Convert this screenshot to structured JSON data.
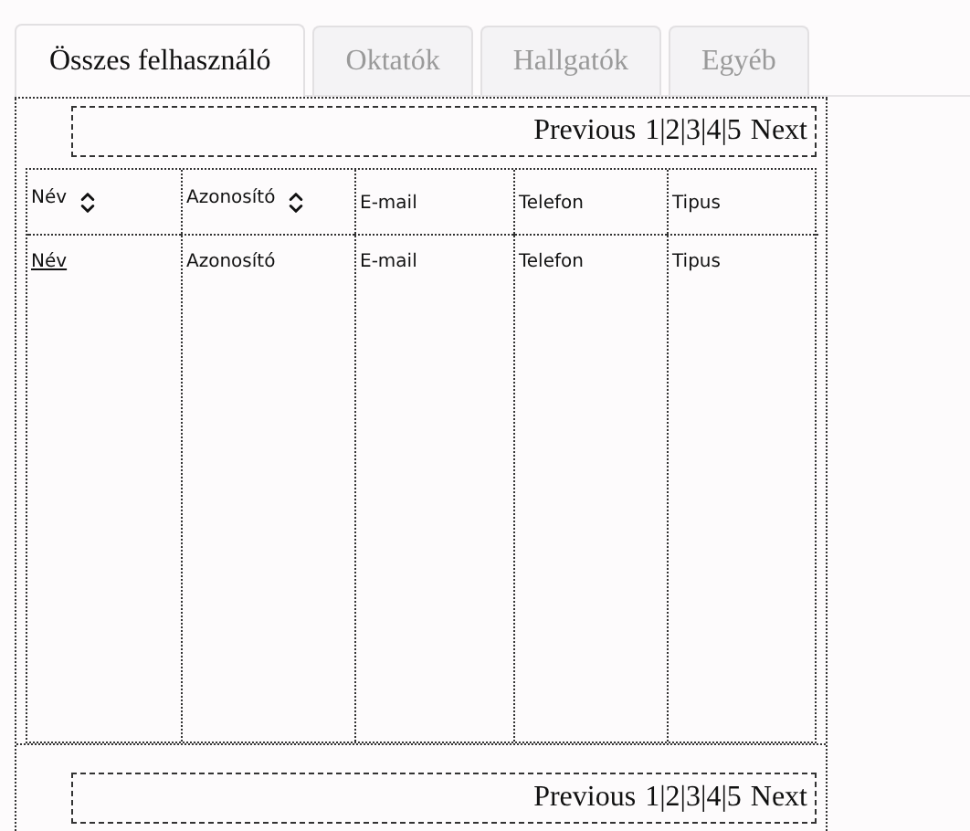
{
  "tabs": [
    {
      "label": "Összes felhasználó",
      "selected": true
    },
    {
      "label": "Oktatók",
      "selected": false
    },
    {
      "label": "Hallgatók",
      "selected": false
    },
    {
      "label": "Egyéb",
      "selected": false
    }
  ],
  "pagers": [
    {
      "previous": "Previous",
      "pages": [
        "1",
        "2",
        "3",
        "4",
        "5"
      ],
      "separator": "|",
      "next": "Next"
    },
    {
      "previous": "Previous",
      "pages": [
        "1",
        "2",
        "3",
        "4",
        "5"
      ],
      "separator": "|",
      "next": "Next"
    }
  ],
  "table": {
    "columns": [
      {
        "label": "Név",
        "kind": "sortable"
      },
      {
        "label": "Azonosító",
        "kind": "sortable"
      },
      {
        "label": "E-mail",
        "kind": "plain"
      },
      {
        "label": "Telefon",
        "kind": "plain"
      },
      {
        "label": "Tipus",
        "kind": "plain"
      }
    ],
    "rows": [
      {
        "cells": [
          {
            "text": "Név",
            "kind": "link"
          },
          {
            "text": "Azonosító",
            "kind": "text"
          },
          {
            "text": "E-mail",
            "kind": "text"
          },
          {
            "text": "Telefon",
            "kind": "text"
          },
          {
            "text": "Tipus",
            "kind": "text"
          }
        ]
      }
    ]
  }
}
